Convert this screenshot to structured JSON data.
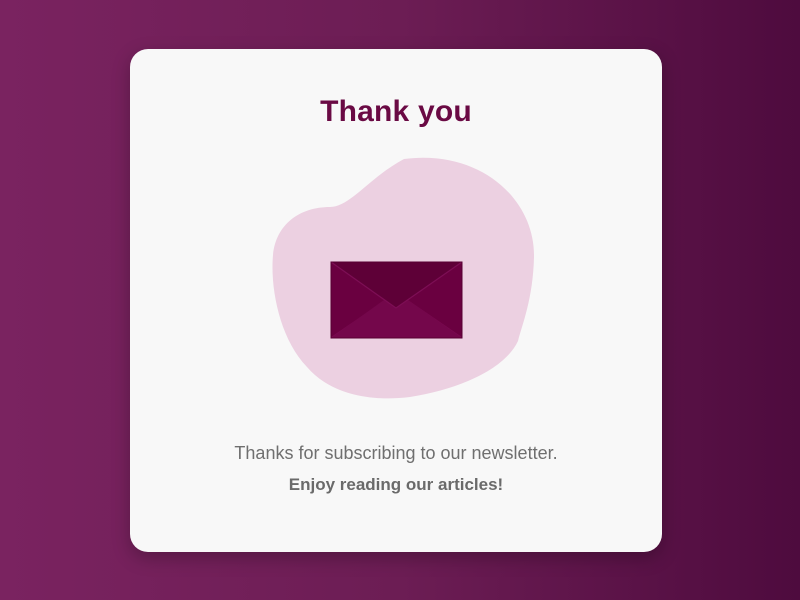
{
  "card": {
    "title": "Thank you",
    "message": "Thanks for subscribing to our newsletter.",
    "emphasis": "Enjoy reading our articles!"
  },
  "illustration": {
    "blob_icon": "blob-shape",
    "envelope_icon": "envelope-icon"
  },
  "colors": {
    "background_start": "#7a2360",
    "background_end": "#4e0b3e",
    "card": "#f8f8f8",
    "title": "#6a0a44",
    "blob": "#ecd0e1",
    "envelope": "#6a0040"
  }
}
